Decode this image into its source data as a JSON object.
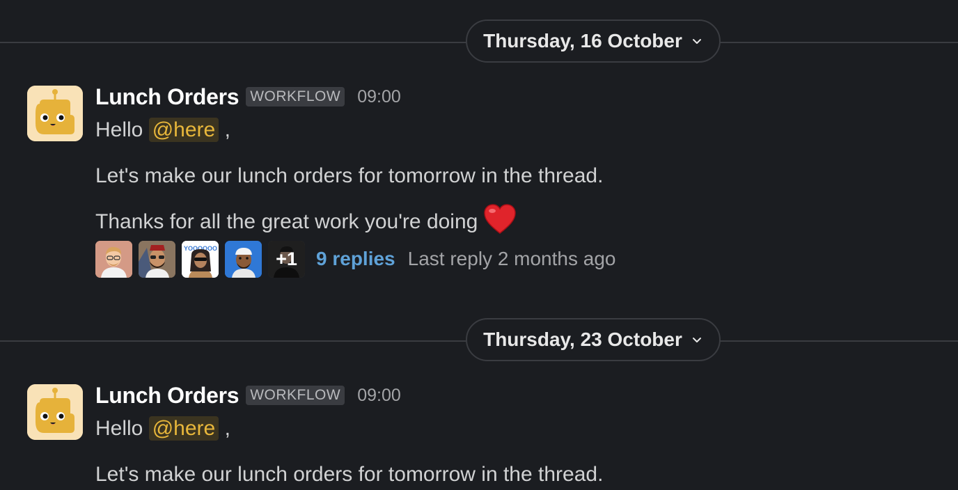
{
  "dividers": [
    {
      "date": "Thursday, 16 October"
    },
    {
      "date": "Thursday, 23 October"
    }
  ],
  "messages": [
    {
      "sender": "Lunch Orders",
      "badge": "WORKFLOW",
      "time": "09:00",
      "greeting": "Hello",
      "mention": "@here",
      "comma": ",",
      "line2": "Let's make our lunch orders for tomorrow in the thread.",
      "line3": "Thanks for all the great work you're doing",
      "heart_icon": "red-heart-emoji",
      "thread": {
        "more_count": "+1",
        "replies": "9 replies",
        "last_reply": "Last reply 2 months ago"
      }
    },
    {
      "sender": "Lunch Orders",
      "badge": "WORKFLOW",
      "time": "09:00",
      "greeting": "Hello",
      "mention": "@here",
      "comma": ",",
      "line2": "Let's make our lunch orders for tomorrow in the thread."
    }
  ],
  "colors": {
    "background": "#1b1d21",
    "mention_text": "#e8b73b",
    "replies_link": "#5fa2d8",
    "avatar_bg": "#f9e2b7",
    "bot_face": "#e6b23a"
  },
  "icons": {
    "bot_avatar": "robot-face-icon",
    "chevron": "chevron-down-icon"
  }
}
